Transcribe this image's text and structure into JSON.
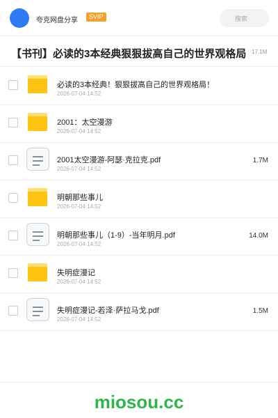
{
  "header": {
    "user_name": "夸克网盘分享",
    "badge": "SVIP",
    "search_placeholder": "搜索"
  },
  "share": {
    "title": "【书刊】必读的3本经典狠狠拔高自己的世界观格局",
    "separator": "·",
    "total_size": "17.1M"
  },
  "items": [
    {
      "type": "folder",
      "name": "必读的3本经典！狠狠拔高自己的世界观格局！",
      "date": "2026-07-04 14:52",
      "size": ""
    },
    {
      "type": "folder",
      "name": "2001：太空漫游",
      "date": "2026-07-04 14:52",
      "size": ""
    },
    {
      "type": "file",
      "name": "2001太空漫游-阿瑟·克拉克.pdf",
      "date": "2026-07-04 14:52",
      "size": "1.7M"
    },
    {
      "type": "folder",
      "name": "明朝那些事儿",
      "date": "2026-07-04 14:52",
      "size": ""
    },
    {
      "type": "file",
      "name": "明朝那些事儿（1-9）-当年明月.pdf",
      "date": "2026-07-04 14:52",
      "size": "14.0M"
    },
    {
      "type": "folder",
      "name": "失明症漫记",
      "date": "2026-07-04 14:52",
      "size": ""
    },
    {
      "type": "file",
      "name": "失明症漫记-若泽·萨拉马戈.pdf",
      "date": "2026-07-04 14:52",
      "size": "1.5M"
    }
  ],
  "icons": {
    "folder": "folder-icon",
    "file": "document-icon"
  },
  "colors": {
    "avatar": "#2f7bf6",
    "badge": "#f6a02c",
    "folder": "#ffc412",
    "watermark": "#2db64a"
  },
  "watermark": "miosou.cc"
}
